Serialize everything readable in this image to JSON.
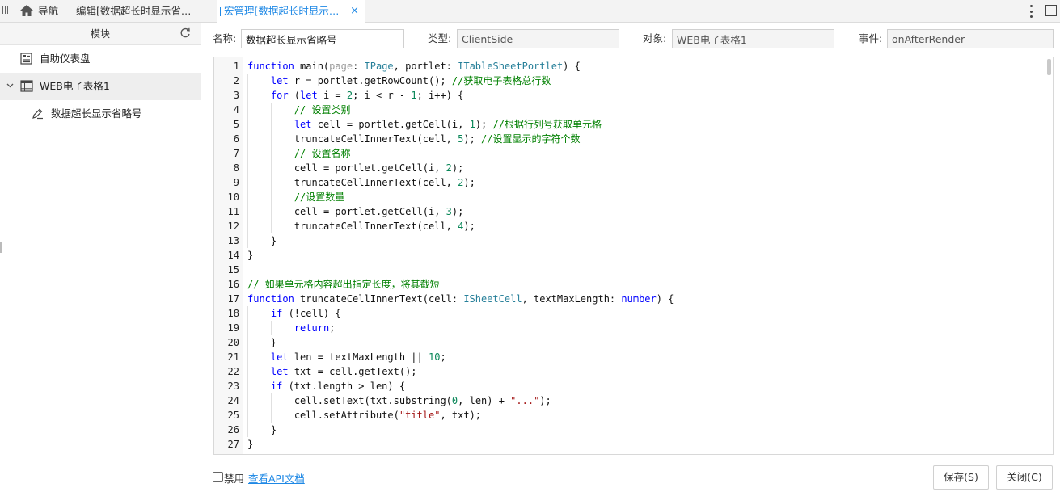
{
  "tabs": {
    "nav_label": "导航",
    "edit_label": "编辑[数据超长时显示省略…",
    "macro_label": "宏管理[数据超长时显示省…",
    "close_glyph": "×"
  },
  "sidebar": {
    "header": "模块",
    "items": [
      {
        "label": "自助仪表盘",
        "icon": "dashboard-icon"
      },
      {
        "label": "WEB电子表格1",
        "icon": "spreadsheet-icon",
        "expanded": true
      },
      {
        "label": "数据超长显示省略号",
        "icon": "macro-script-icon"
      }
    ]
  },
  "form": {
    "name_label": "名称:",
    "name_value": "数据超长显示省略号",
    "type_label": "类型:",
    "type_value": "ClientSide",
    "object_label": "对象:",
    "object_value": "WEB电子表格1",
    "event_label": "事件:",
    "event_value": "onAfterRender"
  },
  "code": [
    {
      "n": "1",
      "indent": 0,
      "tokens": [
        [
          "kw",
          "function"
        ],
        [
          "p",
          " main("
        ],
        [
          "param",
          "page"
        ],
        [
          "p",
          ": "
        ],
        [
          "type",
          "IPage"
        ],
        [
          "p",
          ", portlet: "
        ],
        [
          "type",
          "ITableSheetPortlet"
        ],
        [
          "p",
          ") {"
        ]
      ]
    },
    {
      "n": "2",
      "indent": 1,
      "tokens": [
        [
          "kw",
          "let"
        ],
        [
          "p",
          " r = portlet.getRowCount(); "
        ],
        [
          "cm",
          "//获取电子表格总行数"
        ]
      ]
    },
    {
      "n": "3",
      "indent": 1,
      "tokens": [
        [
          "kw",
          "for"
        ],
        [
          "p",
          " ("
        ],
        [
          "kw",
          "let"
        ],
        [
          "p",
          " i = "
        ],
        [
          "num",
          "2"
        ],
        [
          "p",
          "; i < r - "
        ],
        [
          "num",
          "1"
        ],
        [
          "p",
          "; i++) {"
        ]
      ]
    },
    {
      "n": "4",
      "indent": 2,
      "tokens": [
        [
          "cm",
          "// 设置类别"
        ]
      ]
    },
    {
      "n": "5",
      "indent": 2,
      "tokens": [
        [
          "kw",
          "let"
        ],
        [
          "p",
          " cell = portlet.getCell(i, "
        ],
        [
          "num",
          "1"
        ],
        [
          "p",
          "); "
        ],
        [
          "cm",
          "//根据行列号获取单元格"
        ]
      ]
    },
    {
      "n": "6",
      "indent": 2,
      "tokens": [
        [
          "p",
          "truncateCellInnerText(cell, "
        ],
        [
          "num",
          "5"
        ],
        [
          "p",
          "); "
        ],
        [
          "cm",
          "//设置显示的字符个数"
        ]
      ]
    },
    {
      "n": "7",
      "indent": 2,
      "tokens": [
        [
          "cm",
          "// 设置名称"
        ]
      ]
    },
    {
      "n": "8",
      "indent": 2,
      "tokens": [
        [
          "p",
          "cell = portlet.getCell(i, "
        ],
        [
          "num",
          "2"
        ],
        [
          "p",
          ");"
        ]
      ]
    },
    {
      "n": "9",
      "indent": 2,
      "tokens": [
        [
          "p",
          "truncateCellInnerText(cell, "
        ],
        [
          "num",
          "2"
        ],
        [
          "p",
          ");"
        ]
      ]
    },
    {
      "n": "10",
      "indent": 2,
      "tokens": [
        [
          "cm",
          "//设置数量"
        ]
      ]
    },
    {
      "n": "11",
      "indent": 2,
      "tokens": [
        [
          "p",
          "cell = portlet.getCell(i, "
        ],
        [
          "num",
          "3"
        ],
        [
          "p",
          ");"
        ]
      ]
    },
    {
      "n": "12",
      "indent": 2,
      "tokens": [
        [
          "p",
          "truncateCellInnerText(cell, "
        ],
        [
          "num",
          "4"
        ],
        [
          "p",
          ");"
        ]
      ]
    },
    {
      "n": "13",
      "indent": 1,
      "tokens": [
        [
          "p",
          "}"
        ]
      ]
    },
    {
      "n": "14",
      "indent": 0,
      "tokens": [
        [
          "p",
          "}"
        ]
      ]
    },
    {
      "n": "15",
      "indent": 0,
      "tokens": []
    },
    {
      "n": "16",
      "indent": 0,
      "tokens": [
        [
          "cm",
          "// 如果单元格内容超出指定长度，将其截短"
        ]
      ]
    },
    {
      "n": "17",
      "indent": 0,
      "tokens": [
        [
          "kw",
          "function"
        ],
        [
          "p",
          " truncateCellInnerText(cell: "
        ],
        [
          "type",
          "ISheetCell"
        ],
        [
          "p",
          ", textMaxLength: "
        ],
        [
          "kw",
          "number"
        ],
        [
          "p",
          ") {"
        ]
      ]
    },
    {
      "n": "18",
      "indent": 1,
      "tokens": [
        [
          "kw",
          "if"
        ],
        [
          "p",
          " (!cell) {"
        ]
      ]
    },
    {
      "n": "19",
      "indent": 2,
      "tokens": [
        [
          "kw",
          "return"
        ],
        [
          "p",
          ";"
        ]
      ]
    },
    {
      "n": "20",
      "indent": 1,
      "tokens": [
        [
          "p",
          "}"
        ]
      ]
    },
    {
      "n": "21",
      "indent": 1,
      "tokens": [
        [
          "kw",
          "let"
        ],
        [
          "p",
          " len = textMaxLength || "
        ],
        [
          "num",
          "10"
        ],
        [
          "p",
          ";"
        ]
      ]
    },
    {
      "n": "22",
      "indent": 1,
      "tokens": [
        [
          "kw",
          "let"
        ],
        [
          "p",
          " txt = cell.getText();"
        ]
      ]
    },
    {
      "n": "23",
      "indent": 1,
      "tokens": [
        [
          "kw",
          "if"
        ],
        [
          "p",
          " (txt.length > len) {"
        ]
      ]
    },
    {
      "n": "24",
      "indent": 2,
      "tokens": [
        [
          "p",
          "cell.setText(txt.substring("
        ],
        [
          "num",
          "0"
        ],
        [
          "p",
          ", len) + "
        ],
        [
          "str",
          "\"...\""
        ],
        [
          "p",
          ");"
        ]
      ]
    },
    {
      "n": "25",
      "indent": 2,
      "tokens": [
        [
          "p",
          "cell.setAttribute("
        ],
        [
          "str",
          "\"title\""
        ],
        [
          "p",
          ", txt);"
        ]
      ]
    },
    {
      "n": "26",
      "indent": 1,
      "tokens": [
        [
          "p",
          "}"
        ]
      ]
    },
    {
      "n": "27",
      "indent": 0,
      "tokens": [
        [
          "p",
          "}"
        ]
      ]
    }
  ],
  "footer": {
    "disable_label": "禁用",
    "api_link": "查看API文档",
    "save_label": "保存(S)",
    "close_label": "关闭(C)"
  },
  "colors": {
    "accent": "#1e88e5",
    "keyword": "#0000ff",
    "type": "#267f99",
    "number": "#098658",
    "string": "#a31515",
    "comment": "#008000"
  }
}
